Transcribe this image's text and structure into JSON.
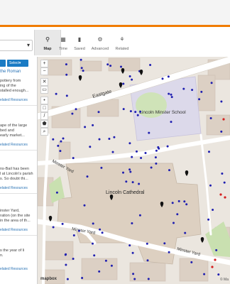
{
  "toolbar": {
    "tabs": [
      {
        "label": "Map",
        "icon": "map-pin-icon"
      },
      {
        "label": "Time",
        "icon": "calendar-icon"
      },
      {
        "label": "Saved",
        "icon": "bookmark-icon"
      },
      {
        "label": "Advanced",
        "icon": "gear-icon"
      },
      {
        "label": "Related",
        "icon": "related-icon"
      }
    ]
  },
  "sidebar": {
    "buttons": [
      "",
      "Select"
    ],
    "cards": [
      {
        "title": "the Roman",
        "lines": [
          "pottery from",
          "ing of the",
          "stalled enough..."
        ],
        "link": "elated Resources"
      },
      {
        "title": "",
        "lines": [
          "ape of the large",
          "bed and",
          "early market..."
        ],
        "link": "elated Resources"
      },
      {
        "title": "",
        "lines": [
          "ns-Bail has been",
          "l at Lincoln's parish",
          "s. So doubt thi..."
        ],
        "link": "elated Resources"
      },
      {
        "title": "",
        "lines": [
          "inster Yard,",
          "ration (on the site",
          "in the area of th..."
        ],
        "link": "elated Resources"
      },
      {
        "title": "",
        "lines": [
          "s the year of li",
          "n."
        ],
        "link": "elated Resources"
      }
    ]
  },
  "map": {
    "labels": {
      "eastgate": "Eastgate",
      "school": "Lincoln Minster School",
      "cathedral": "Lincoln Cathedral",
      "minster_yard_a": "Minster Yard",
      "minster_yard_b": "Minster Yard",
      "minster_yard_c": "Minster Yard"
    },
    "logo": "mapbox",
    "attribution": "© Ma",
    "marker_color": "#1f1fb0",
    "controls": [
      "+",
      "−",
      "✕",
      "▭",
      "•",
      "□",
      "/",
      "⬟",
      "⌕"
    ]
  },
  "colors": {
    "accent": "#f07c00",
    "primary": "#1a7bc4"
  }
}
